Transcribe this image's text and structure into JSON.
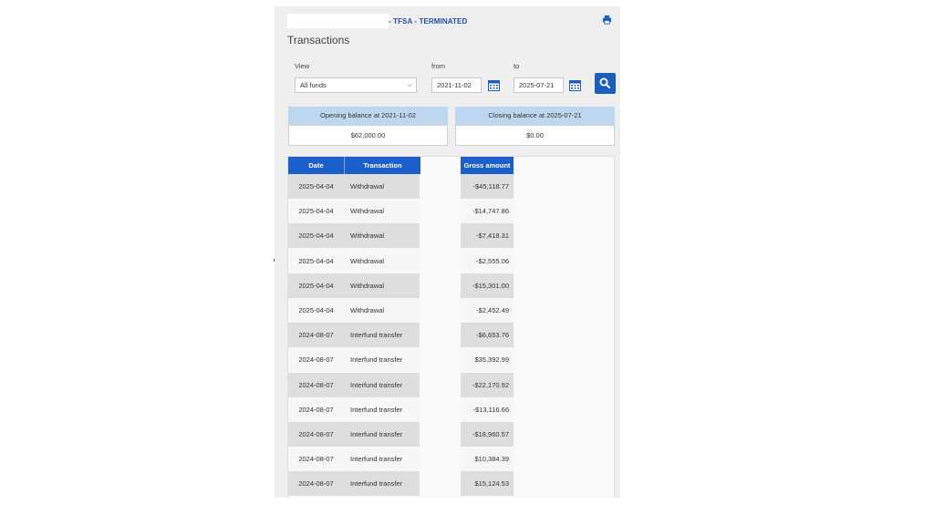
{
  "header": {
    "account_status": "- TFSA - TERMINATED",
    "title": "Transactions"
  },
  "filters": {
    "view_label": "View",
    "view_value": "All funds",
    "from_label": "from",
    "from_value": "2021-11-02",
    "to_label": "to",
    "to_value": "2025-07-21"
  },
  "balances": {
    "opening_label": "Opening balance at 2021-11-02",
    "opening_value": "$62,000.00",
    "closing_label": "Closing balance at 2025-07-21",
    "closing_value": "$0.00"
  },
  "table": {
    "columns": [
      "Date",
      "Transaction",
      "Gross amount"
    ],
    "rows": [
      {
        "date": "2025-04-04",
        "type": "Withdrawal",
        "amount": "-$45,118.77"
      },
      {
        "date": "2025-04-04",
        "type": "Withdrawal",
        "amount": "-$14,747.86"
      },
      {
        "date": "2025-04-04",
        "type": "Withdrawal",
        "amount": "-$7,418.31"
      },
      {
        "date": "2025-04-04",
        "type": "Withdrawal",
        "amount": "-$2,555.06"
      },
      {
        "date": "2025-04-04",
        "type": "Withdrawal",
        "amount": "-$15,301.00"
      },
      {
        "date": "2025-04-04",
        "type": "Withdrawal",
        "amount": "-$2,452.49"
      },
      {
        "date": "2024-08-07",
        "type": "Interfund transfer",
        "amount": "-$6,653.76"
      },
      {
        "date": "2024-08-07",
        "type": "Interfund transfer",
        "amount": "$35,392.99"
      },
      {
        "date": "2024-08-07",
        "type": "Interfund transfer",
        "amount": "-$22,170.92"
      },
      {
        "date": "2024-08-07",
        "type": "Interfund transfer",
        "amount": "-$13,116.66"
      },
      {
        "date": "2024-08-07",
        "type": "Interfund transfer",
        "amount": "-$18,960.57"
      },
      {
        "date": "2024-08-07",
        "type": "Interfund transfer",
        "amount": "$10,384.39"
      },
      {
        "date": "2024-08-07",
        "type": "Interfund transfer",
        "amount": "$15,124.53"
      }
    ]
  },
  "icons": {
    "print": "printer-icon",
    "calendar": "calendar-icon",
    "search": "search-icon"
  },
  "colors": {
    "accent": "#1a5fcc",
    "balance_header": "#bdd7f0",
    "status_text": "#1f4fa8"
  }
}
